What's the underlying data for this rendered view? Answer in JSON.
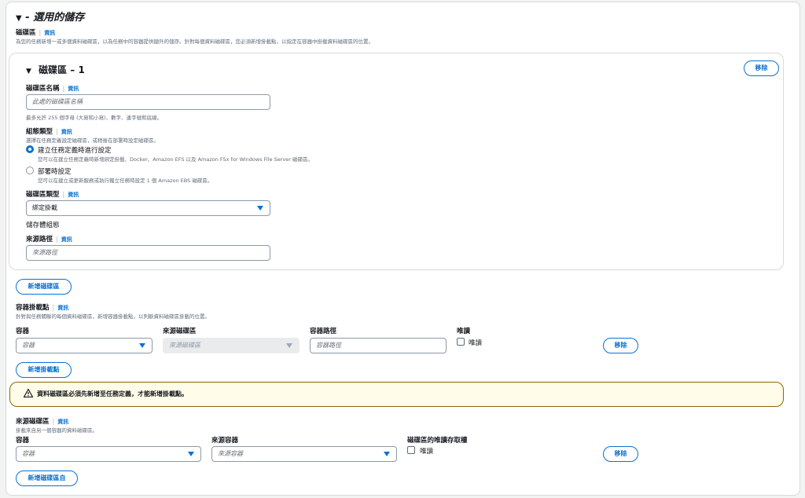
{
  "storage": {
    "title": "- 選用的儲存",
    "volumes_label": "磁碟區",
    "info": "資訊",
    "volumes_desc": "為您的任務新增一或多個資料磁碟區，以為任務中的容器提供額外的儲存。針對每個資料磁碟區，您必須新增掛載點，以指定在容器中掛載資料磁碟區的位置。",
    "volume": {
      "title": "磁碟區 – 1",
      "remove": "移除",
      "name_label": "磁碟區名稱",
      "name_placeholder": "此處的磁碟區名稱",
      "name_hint": "最多允許 255 個字母 (大寫和小寫)、數字、連字號和底線。",
      "config_label": "組態類型",
      "config_desc": "選擇在任務定義設定磁碟區，或稍後在部署時設定磁碟區。",
      "opt1_label": "建立任務定義時進行設定",
      "opt1_desc": "您可以在建立任務定義時新增綁定掛載、Docker、Amazon EFS 以及 Amazon FSx for Windows File Server 磁碟區。",
      "opt2_label": "部署時設定",
      "opt2_desc": "您可以在建立或更新服務或執行獨立任務時設定 1 個 Amazon EBS 磁碟區。",
      "type_label": "磁碟區類型",
      "type_value": "綁定掛載",
      "storage_config_label": "儲存體組態",
      "source_path_label": "來源路徑",
      "source_path_placeholder": "來源路徑"
    },
    "add_volume": "新增磁碟區",
    "mount": {
      "label": "容器掛載點",
      "desc": "針對與任務關聯的每個資料磁碟區，新增容器掛載點，以判斷資料磁碟區掛載的位置。",
      "col_container": "容器",
      "col_source_volume": "來源磁碟區",
      "col_container_path": "容器路徑",
      "col_readonly": "唯讀",
      "container_placeholder": "容器",
      "source_volume_placeholder": "來源磁碟區",
      "container_path_placeholder": "容器路徑",
      "readonly_label": "唯讀",
      "remove": "移除"
    },
    "add_mount": "新增掛載點",
    "alert": "資料磁碟區必須先新增至任務定義，才能新增掛載點。",
    "volumes_from": {
      "label": "來源磁碟區",
      "desc": "掛載來自另一個容器的資料磁碟區。",
      "col_container": "容器",
      "col_source_container": "來源容器",
      "col_readonly": "磁碟區的唯讀存取權",
      "container_placeholder": "容器",
      "source_container_placeholder": "來源容器",
      "readonly_label": "唯讀",
      "remove": "移除"
    },
    "add_volumes_from": "新增磁碟區自"
  },
  "colors": {
    "accent": "#0972d3",
    "warning_border": "#8d6605",
    "warning_bg": "#fffce9"
  }
}
